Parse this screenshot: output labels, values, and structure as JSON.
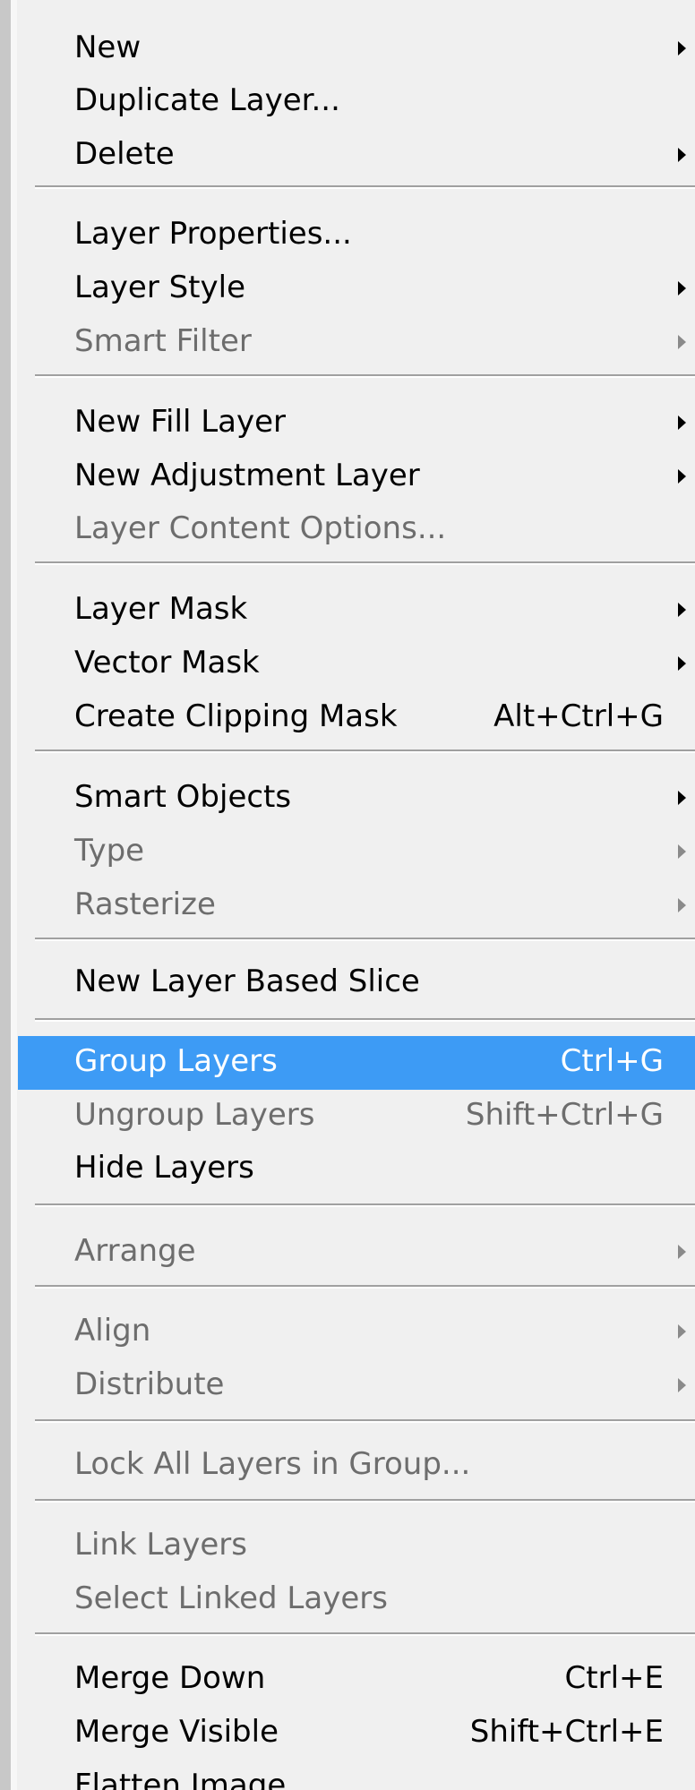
{
  "menu": {
    "items": [
      {
        "label": "New",
        "submenu": true
      },
      {
        "label": "Duplicate Layer...",
        "submenu": false
      },
      {
        "label": "Delete",
        "submenu": true
      },
      {
        "label": "Layer Properties...",
        "submenu": false
      },
      {
        "label": "Layer Style",
        "submenu": true
      },
      {
        "label": "Smart Filter",
        "submenu": true,
        "disabled": true
      },
      {
        "label": "New Fill Layer",
        "submenu": true
      },
      {
        "label": "New Adjustment Layer",
        "submenu": true
      },
      {
        "label": "Layer Content Options...",
        "disabled": true
      },
      {
        "label": "Layer Mask",
        "submenu": true
      },
      {
        "label": "Vector Mask",
        "submenu": true
      },
      {
        "label": "Create Clipping Mask",
        "shortcut": "Alt+Ctrl+G"
      },
      {
        "label": "Smart Objects",
        "submenu": true
      },
      {
        "label": "Type",
        "submenu": true,
        "disabled": true
      },
      {
        "label": "Rasterize",
        "submenu": true,
        "disabled": true
      },
      {
        "label": "New Layer Based Slice"
      },
      {
        "label": "Group Layers",
        "shortcut": "Ctrl+G",
        "highlighted": true
      },
      {
        "label": "Ungroup Layers",
        "shortcut": "Shift+Ctrl+G",
        "disabled": true
      },
      {
        "label": "Hide Layers"
      },
      {
        "label": "Arrange",
        "submenu": true,
        "disabled": true
      },
      {
        "label": "Align",
        "submenu": true,
        "disabled": true
      },
      {
        "label": "Distribute",
        "submenu": true,
        "disabled": true
      },
      {
        "label": "Lock All Layers in Group...",
        "disabled": true
      },
      {
        "label": "Link Layers",
        "disabled": true
      },
      {
        "label": "Select Linked Layers",
        "disabled": true
      },
      {
        "label": "Merge Down",
        "shortcut": "Ctrl+E"
      },
      {
        "label": "Merge Visible",
        "shortcut": "Shift+Ctrl+E"
      },
      {
        "label": "Flatten Image"
      }
    ]
  },
  "colors": {
    "menu_background": "#f0f0f0",
    "highlight": "#3d9bf5",
    "disabled_text": "#6d6d6d"
  },
  "icons": {
    "submenu": "submenu-arrow-icon"
  }
}
